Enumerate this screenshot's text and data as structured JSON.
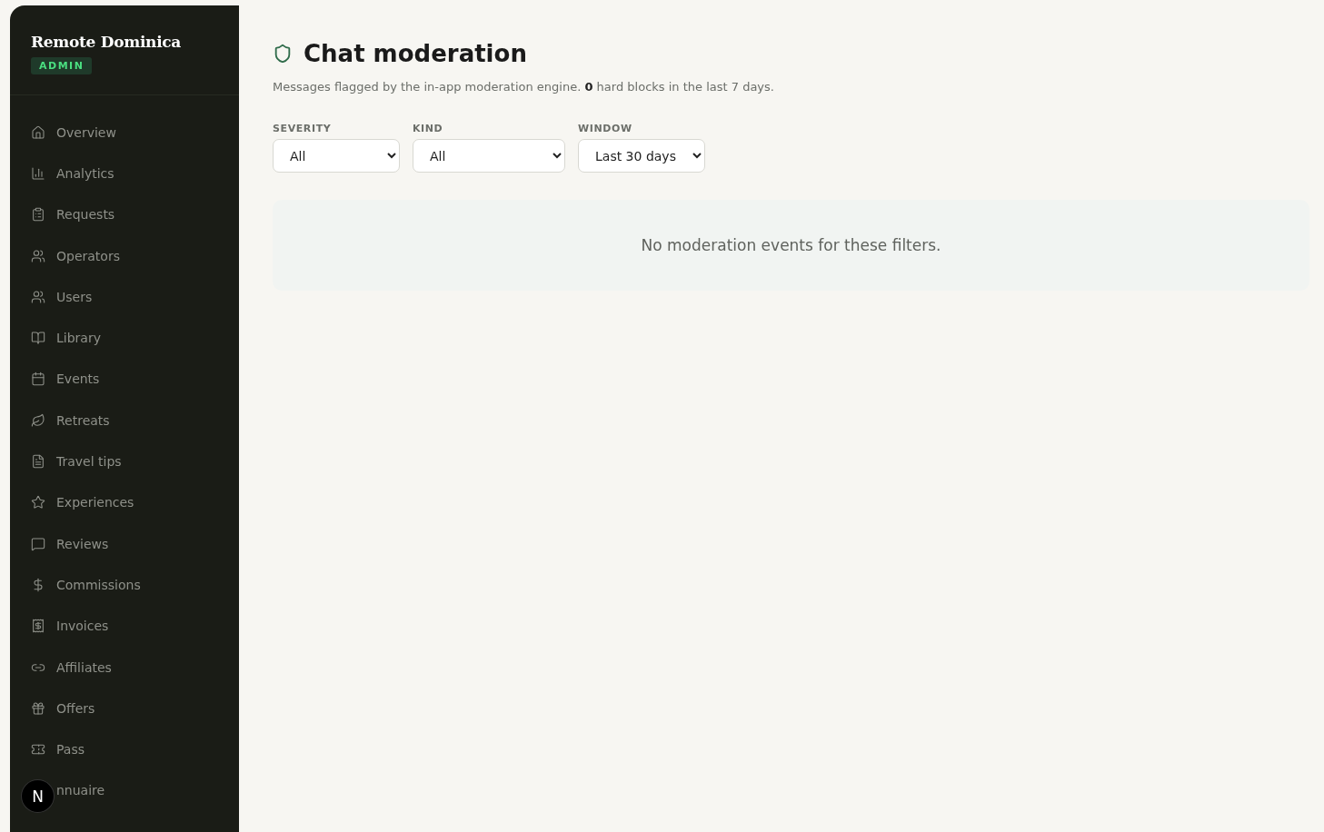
{
  "sidebar": {
    "brand": "Remote Dominica",
    "badge": "ADMIN",
    "items": [
      {
        "label": "Overview",
        "selected": false
      },
      {
        "label": "Analytics",
        "selected": false
      },
      {
        "label": "Requests",
        "selected": false
      },
      {
        "label": "Operators",
        "selected": false
      },
      {
        "label": "Users",
        "selected": false
      },
      {
        "label": "Library",
        "selected": false
      },
      {
        "label": "Events",
        "selected": false
      },
      {
        "label": "Retreats",
        "selected": false
      },
      {
        "label": "Travel tips",
        "selected": false
      },
      {
        "label": "Experiences",
        "selected": false
      },
      {
        "label": "Reviews",
        "selected": false
      },
      {
        "label": "Commissions",
        "selected": false
      },
      {
        "label": "Invoices",
        "selected": false
      },
      {
        "label": "Affiliates",
        "selected": false
      },
      {
        "label": "Offers",
        "selected": false
      },
      {
        "label": "Pass",
        "selected": false
      },
      {
        "label": "nnuaire",
        "selected": false
      }
    ]
  },
  "dev_badge": "N",
  "page": {
    "title": "Chat moderation",
    "subtitle": "Messages flagged by the in-app moderation engine. **0** hard blocks in the last 7 days.",
    "filters": [
      {
        "label": "SEVERITY",
        "value": "All"
      },
      {
        "label": "KIND",
        "value": "All"
      },
      {
        "label": "WINDOW",
        "value": "Last 30 days"
      }
    ],
    "empty_message": "No moderation events for these filters."
  }
}
